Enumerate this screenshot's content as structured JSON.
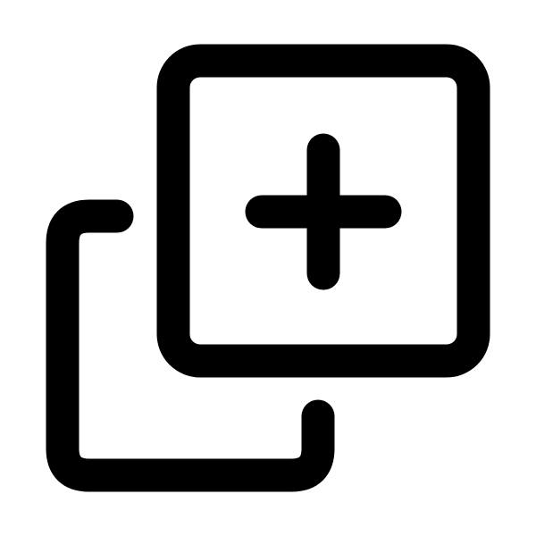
{
  "icon": {
    "name": "add-to-collection-icon",
    "color": "#000000",
    "background": "#ffffff"
  }
}
